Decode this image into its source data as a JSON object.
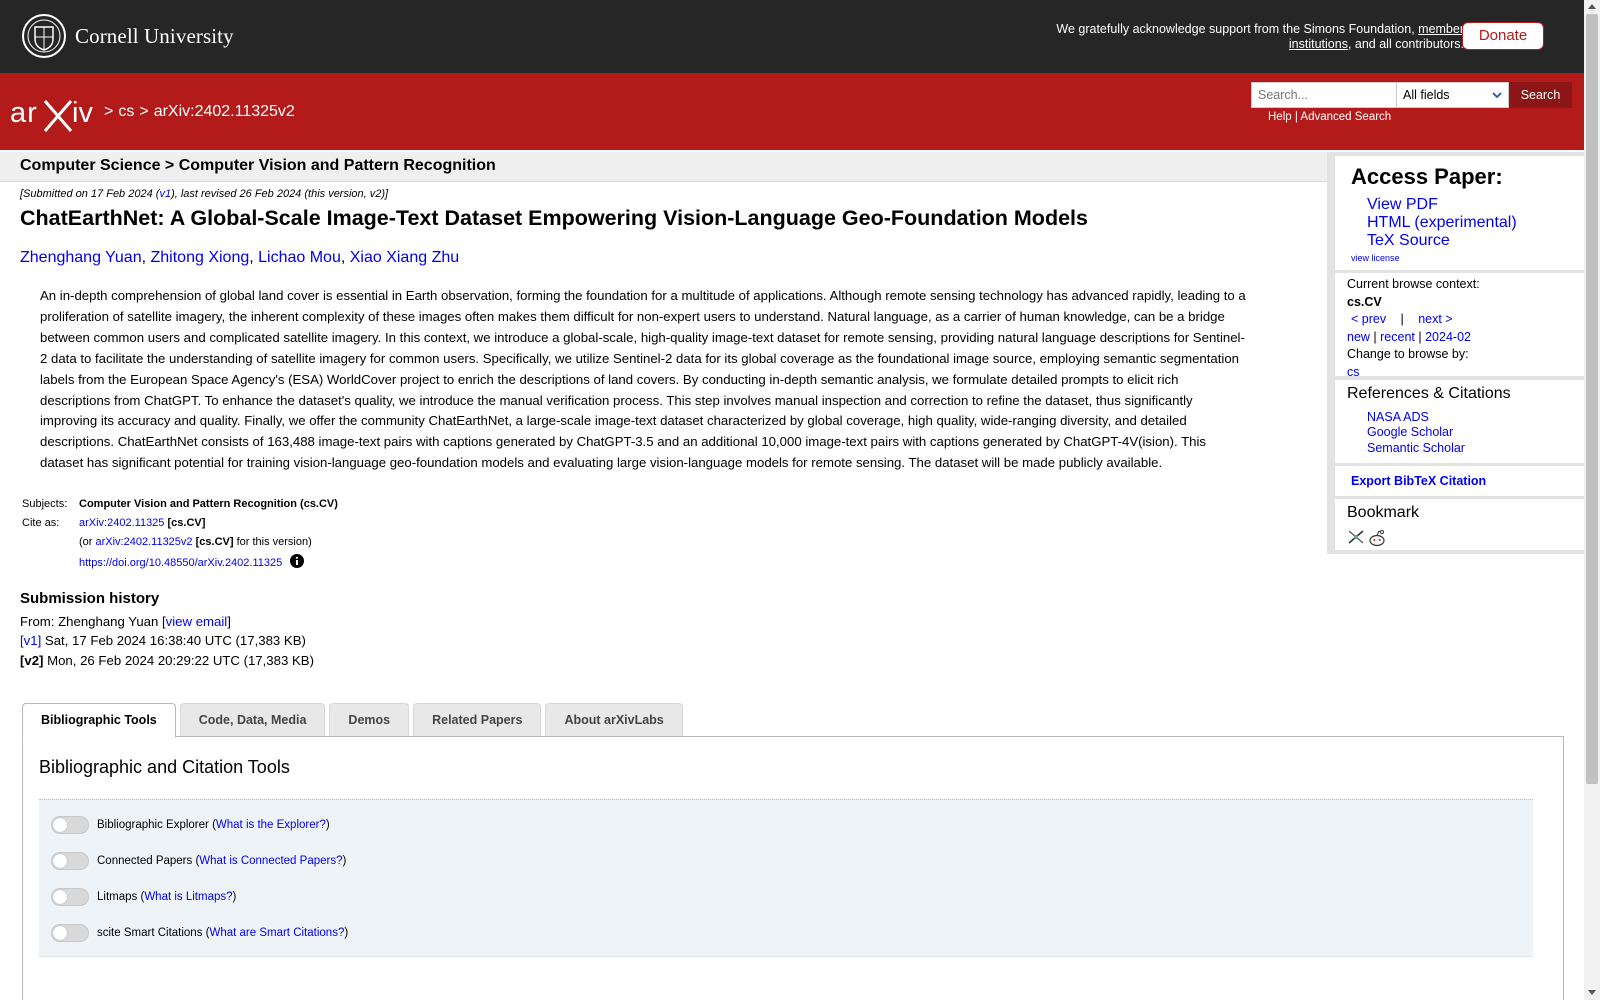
{
  "topbar": {
    "university": "Cornell University",
    "support_prefix": "We gratefully acknowledge support from the Simons Foundation, ",
    "support_link": "member institutions",
    "support_suffix": ", and all contributors.",
    "donate": "Donate"
  },
  "header": {
    "logo_text": "arXiv",
    "crumb_sep1": ">",
    "crumb_cs": "cs",
    "crumb_sep2": ">",
    "crumb_id": "arXiv:2402.11325v2",
    "search_placeholder": "Search...",
    "search_field": "All fields",
    "search_button": "Search",
    "help": "Help",
    "help_sep": "|",
    "advanced_search": "Advanced Search"
  },
  "subheader": "Computer Science > Computer Vision and Pattern Recognition",
  "dateline": {
    "prefix": "[Submitted on 17 Feb 2024 (",
    "v1": "v1",
    "suffix": "), last revised 26 Feb 2024 (this version, v2)]"
  },
  "title": "ChatEarthNet: A Global-Scale Image-Text Dataset Empowering Vision-Language Geo-Foundation Models",
  "authors": [
    "Zhenghang Yuan",
    "Zhitong Xiong",
    "Lichao Mou",
    "Xiao Xiang Zhu"
  ],
  "abstract_lines": [
    "An in-depth comprehension of global land cover is essential in Earth observation, forming the foundation for a multitude of applications. Although remote sensing technology has advanced rapidly, leading to a",
    "proliferation of satellite imagery, the inherent complexity of these images often makes them difficult for non-expert users to understand. Natural language, as a carrier of human knowledge, can be a bridge",
    "between common users and complicated satellite imagery. In this context, we introduce a global-scale, high-quality image-text dataset for remote sensing, providing natural language descriptions for Sentinel-",
    "2 data to facilitate the understanding of satellite imagery for common users. Specifically, we utilize Sentinel-2 data for its global coverage as the foundational image source, employing semantic segmentation",
    "labels from the European Space Agency's (ESA) WorldCover project to enrich the descriptions of land covers. By conducting in-depth semantic analysis, we formulate detailed prompts to elicit rich",
    "descriptions from ChatGPT. To enhance the dataset's quality, we introduce the manual verification process. This step involves manual inspection and correction to refine the dataset, thus significantly",
    "improving its accuracy and quality. Finally, we offer the community ChatEarthNet, a large-scale image-text dataset characterized by global coverage, high quality, wide-ranging diversity, and detailed",
    "descriptions. ChatEarthNet consists of 163,488 image-text pairs with captions generated by ChatGPT-3.5 and an additional 10,000 image-text pairs with captions generated by ChatGPT-4V(ision). This",
    "dataset has significant potential for training vision-language geo-foundation models and evaluating large vision-language models for remote sensing. The dataset will be made publicly available."
  ],
  "meta": {
    "subjects_label": "Subjects:",
    "subjects_value": "Computer Vision and Pattern Recognition (cs.CV)",
    "cite_label": "Cite as:",
    "cite_id": "arXiv:2402.11325",
    "cite_tag": "[cs.CV]",
    "cite_v_prefix": "(or ",
    "cite_v_id": "arXiv:2402.11325v2",
    "cite_v_tag": "[cs.CV]",
    "cite_v_suffix": " for this version)",
    "doi": "https://doi.org/10.48550/arXiv.2402.11325"
  },
  "history": {
    "heading": "Submission history",
    "from_prefix": "From: Zhenghang Yuan [",
    "view_email": "view email",
    "from_suffix": "]",
    "v1_label": "[v1]",
    "v1_text": " Sat, 17 Feb 2024 16:38:40 UTC (17,383 KB)",
    "v2_label": "[v2]",
    "v2_text": " Mon, 26 Feb 2024 20:29:22 UTC (17,383 KB)"
  },
  "tabs": [
    "Bibliographic Tools",
    "Code, Data, Media",
    "Demos",
    "Related Papers",
    "About arXivLabs"
  ],
  "tools": {
    "heading": "Bibliographic and Citation Tools",
    "items": [
      {
        "name": "Bibliographic Explorer",
        "link": "What is the Explorer?"
      },
      {
        "name": "Connected Papers",
        "link": "What is Connected Papers?"
      },
      {
        "name": "Litmaps",
        "link": "What is Litmaps?"
      },
      {
        "name": "scite Smart Citations",
        "link": "What are Smart Citations?"
      }
    ]
  },
  "sidebar": {
    "access_heading": "Access Paper:",
    "view_pdf": "View PDF",
    "html": "HTML (experimental)",
    "tex": "TeX Source",
    "license": "view license",
    "context_label": "Current browse context:",
    "context_value": "cs.CV",
    "prev": "< prev",
    "nav_sep": "|",
    "next": "next >",
    "new": "new",
    "recent": "recent",
    "month": "2024-02",
    "change_label": "Change to browse by:",
    "change_value": "cs",
    "refs_heading": "References & Citations",
    "nasa": "NASA ADS",
    "google": "Google Scholar",
    "semantic": "Semantic Scholar",
    "bibtex": "Export BibTeX Citation",
    "bookmark_heading": "Bookmark"
  },
  "colors": {
    "arxiv_red": "#b31b1b",
    "topbar": "#262626",
    "link": "#0000ee"
  }
}
